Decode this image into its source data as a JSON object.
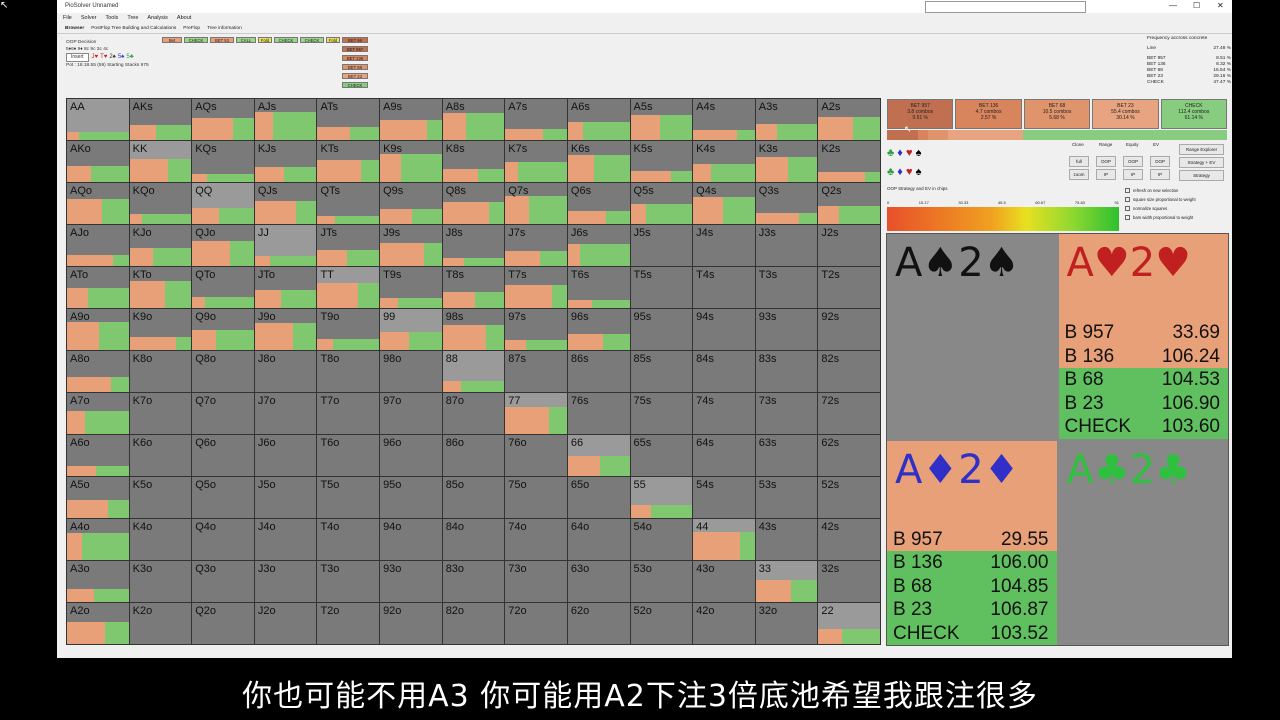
{
  "window": {
    "title": "PioSolver Unnamed",
    "controls": [
      "—",
      "☐",
      "✕"
    ]
  },
  "menu": [
    "File",
    "Solver",
    "Tools",
    "Tree",
    "Analysis",
    "About"
  ],
  "subtabs": [
    "Browser",
    "PostFlop Tree Building and Calculations",
    "PreFlop",
    "Tree information"
  ],
  "decision": {
    "label": "OOP Decision",
    "board": "5♦6♦ 9♦ 8c 9c 3c 4c",
    "insert": "Insert",
    "suits": [
      "J♥",
      "T♥",
      "2♠",
      "5♠",
      "5♣"
    ],
    "pot": "Pot : 18.18.55 (59) Starting Stacks 975"
  },
  "tree": {
    "row1": [
      "Bet",
      "CHECK",
      "BET 53",
      "CALL",
      "Fold",
      "CHECK",
      "CHECK",
      "Fold",
      "BET 96"
    ],
    "col": [
      "BET 957",
      "BET 136",
      "BET 68",
      "BET 23",
      "CHECK"
    ]
  },
  "freq": {
    "title": "Frequency accross concrete",
    "rows": [
      [
        "Line",
        "27.48 %"
      ],
      [
        "BET 957",
        "8.51 %"
      ],
      [
        "BET 136",
        "8.32 %"
      ],
      [
        "BET 68",
        "16.54 %"
      ],
      [
        "BET 23",
        "29.16 %"
      ],
      [
        "CHECK",
        "47.47 %"
      ]
    ]
  },
  "grid": {
    "ranks": [
      "A",
      "K",
      "Q",
      "J",
      "T",
      "9",
      "8",
      "7",
      "6",
      "5",
      "4",
      "3",
      "2"
    ]
  },
  "actions": [
    {
      "name": "BET 957",
      "combos": "3.8 combos",
      "pct": "9.51 %",
      "color": "#c07050"
    },
    {
      "name": "BET 136",
      "combos": "4.7 combos",
      "pct": "2.57 %",
      "color": "#d8845c"
    },
    {
      "name": "BET 68",
      "combos": "10.5 combos",
      "pct": "5.68 %",
      "color": "#e0946c"
    },
    {
      "name": "BET 23",
      "combos": "55.4 combos",
      "pct": "30.14 %",
      "color": "#e8a480"
    },
    {
      "name": "CHECK",
      "combos": "112.4 combos",
      "pct": "61.14 %",
      "color": "#88cc80"
    }
  ],
  "controls": {
    "headers": [
      "Clone",
      "Range",
      "Equity",
      "EV"
    ],
    "btns": [
      "full",
      "OOP",
      "OOP",
      "OOP",
      "zoom",
      "IP",
      "IP",
      "IP"
    ],
    "explorer": "Range Explorer",
    "strategy_ev": "Strategy + EV",
    "strategy": "Strategy"
  },
  "strategy_label": "OOP Strategy and EV in chips",
  "scale": [
    "0",
    "15.17",
    "30.33",
    "45.5",
    "60.67",
    "75.83",
    "91"
  ],
  "options": [
    "refresh on new selection",
    "square size proportional to weight",
    "normalize squares",
    "bars width proportional to weight"
  ],
  "combos": [
    {
      "name": "A♠2♠",
      "color": "#111",
      "rows": [],
      "top": "#888"
    },
    {
      "name": "A♥2♥",
      "color": "#c02020",
      "top": "#e8a078",
      "rows": [
        [
          "B 957",
          "33.69",
          "#e8a078"
        ],
        [
          "B 136",
          "106.24",
          "#e8a078"
        ],
        [
          "B 68",
          "104.53",
          "#60c060"
        ],
        [
          "B 23",
          "106.90",
          "#60c060"
        ],
        [
          "CHECK",
          "103.60",
          "#60c060"
        ]
      ]
    },
    {
      "name": "A♦2♦",
      "color": "#3030c8",
      "top": "#e8a078",
      "rows": [
        [
          "B 957",
          "29.55",
          "#e8a078"
        ],
        [
          "B 136",
          "106.00",
          "#60c060"
        ],
        [
          "B 68",
          "104.85",
          "#60c060"
        ],
        [
          "B 23",
          "106.87",
          "#60c060"
        ],
        [
          "CHECK",
          "103.52",
          "#60c060"
        ]
      ]
    },
    {
      "name": "A♣2♣",
      "color": "#30c040",
      "rows": [],
      "top": "#888"
    }
  ],
  "subtitle": "你也可能不用A3 你可能用A2下注3倍底池希望我跟注很多",
  "colors": {
    "bet": "#e8a078",
    "check": "#80c870",
    "grey": "#7a7a7a"
  }
}
